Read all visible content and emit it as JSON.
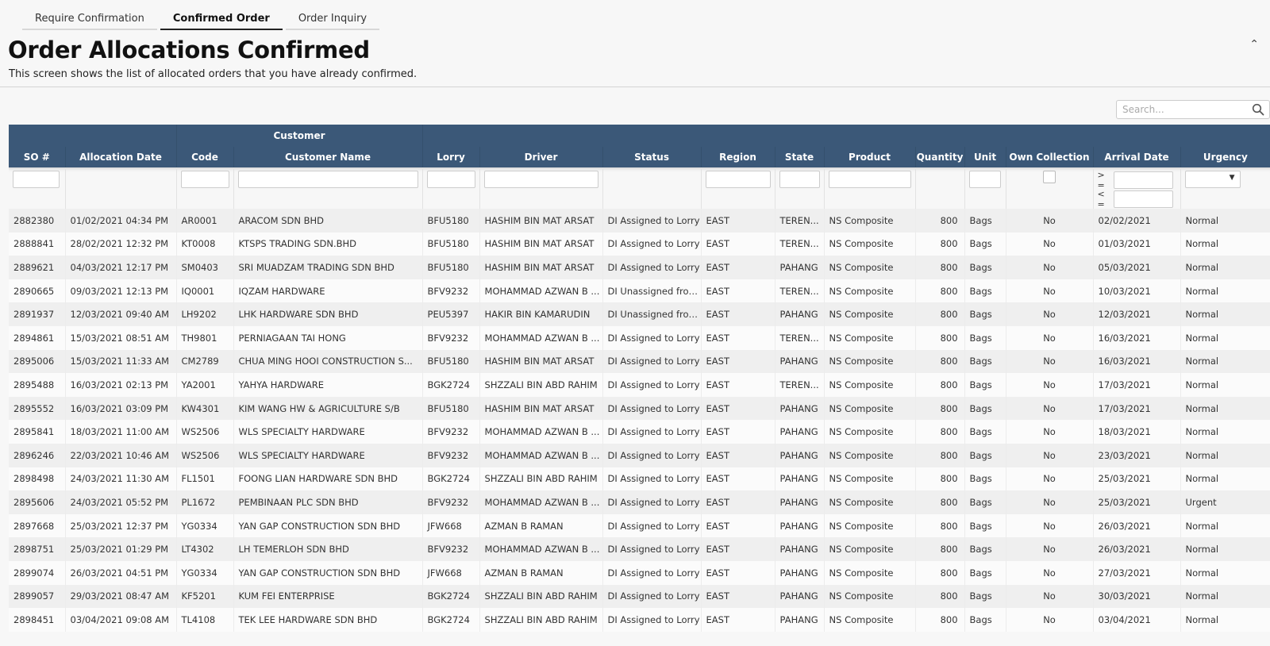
{
  "tabs": [
    {
      "label": "Require Confirmation"
    },
    {
      "label": "Confirmed Order"
    },
    {
      "label": "Order Inquiry"
    }
  ],
  "page": {
    "title": "Order Allocations Confirmed",
    "description": "This screen shows the list of allocated orders that you have already confirmed."
  },
  "search": {
    "placeholder": "Search..."
  },
  "icons": {
    "search": "search-icon",
    "collapse": "chevron-up-icon",
    "dropdown": "caret-down-icon"
  },
  "colors": {
    "header_bg": "#3b5878",
    "row_odd": "#efefef",
    "row_even": "#fbfbfb"
  },
  "table": {
    "group_header": "Customer",
    "columns": [
      "SO #",
      "Allocation Date",
      "Code",
      "Customer Name",
      "Lorry",
      "Driver",
      "Status",
      "Region",
      "State",
      "Product",
      "Quantity",
      "Unit",
      "Own Collection",
      "Arrival Date",
      "Urgency"
    ],
    "date_filter": {
      "gte_label": "> =",
      "lte_label": "< ="
    },
    "rows": [
      [
        "2882380",
        "01/02/2021 04:34 PM",
        "AR0001",
        "ARACOM SDN BHD",
        "BFU5180",
        "HASHIM BIN MAT ARSAT",
        "DI Assigned to Lorry",
        "EAST",
        "TEREN...",
        "NS Composite",
        "800",
        "Bags",
        "No",
        "02/02/2021",
        "Normal"
      ],
      [
        "2888841",
        "28/02/2021 12:32 PM",
        "KT0008",
        "KTSPS TRADING SDN.BHD",
        "BFU5180",
        "HASHIM BIN MAT ARSAT",
        "DI Assigned to Lorry",
        "EAST",
        "TEREN...",
        "NS Composite",
        "800",
        "Bags",
        "No",
        "01/03/2021",
        "Normal"
      ],
      [
        "2889621",
        "04/03/2021 12:17 PM",
        "SM0403",
        "SRI MUADZAM TRADING SDN BHD",
        "BFU5180",
        "HASHIM BIN MAT ARSAT",
        "DI Assigned to Lorry",
        "EAST",
        "PAHANG",
        "NS Composite",
        "800",
        "Bags",
        "No",
        "05/03/2021",
        "Normal"
      ],
      [
        "2890665",
        "09/03/2021 12:13 PM",
        "IQ0001",
        "IQZAM HARDWARE",
        "BFV9232",
        "MOHAMMAD AZWAN B ...",
        "DI Unassigned from...",
        "EAST",
        "TEREN...",
        "NS Composite",
        "800",
        "Bags",
        "No",
        "10/03/2021",
        "Normal"
      ],
      [
        "2891937",
        "12/03/2021 09:40 AM",
        "LH9202",
        "LHK HARDWARE SDN BHD",
        "PEU5397",
        "HAKIR BIN KAMARUDIN",
        "DI Unassigned from...",
        "EAST",
        "PAHANG",
        "NS Composite",
        "800",
        "Bags",
        "No",
        "12/03/2021",
        "Normal"
      ],
      [
        "2894861",
        "15/03/2021 08:51 AM",
        "TH9801",
        "PERNIAGAAN TAI HONG",
        "BFV9232",
        "MOHAMMAD AZWAN B ...",
        "DI Assigned to Lorry",
        "EAST",
        "TEREN...",
        "NS Composite",
        "800",
        "Bags",
        "No",
        "16/03/2021",
        "Normal"
      ],
      [
        "2895006",
        "15/03/2021 11:33 AM",
        "CM2789",
        "CHUA MING HOOI CONSTRUCTION S...",
        "BFU5180",
        "HASHIM BIN MAT ARSAT",
        "DI Assigned to Lorry",
        "EAST",
        "PAHANG",
        "NS Composite",
        "800",
        "Bags",
        "No",
        "16/03/2021",
        "Normal"
      ],
      [
        "2895488",
        "16/03/2021 02:13 PM",
        "YA2001",
        "YAHYA HARDWARE",
        "BGK2724",
        "SHZZALI BIN ABD RAHIM",
        "DI Assigned to Lorry",
        "EAST",
        "TEREN...",
        "NS Composite",
        "800",
        "Bags",
        "No",
        "17/03/2021",
        "Normal"
      ],
      [
        "2895552",
        "16/03/2021 03:09 PM",
        "KW4301",
        "KIM WANG HW & AGRICULTURE S/B",
        "BFU5180",
        "HASHIM BIN MAT ARSAT",
        "DI Assigned to Lorry",
        "EAST",
        "PAHANG",
        "NS Composite",
        "800",
        "Bags",
        "No",
        "17/03/2021",
        "Normal"
      ],
      [
        "2895841",
        "18/03/2021 11:00 AM",
        "WS2506",
        "WLS SPECIALTY HARDWARE",
        "BFV9232",
        "MOHAMMAD AZWAN B ...",
        "DI Assigned to Lorry",
        "EAST",
        "PAHANG",
        "NS Composite",
        "800",
        "Bags",
        "No",
        "18/03/2021",
        "Normal"
      ],
      [
        "2896246",
        "22/03/2021 10:46 AM",
        "WS2506",
        "WLS SPECIALTY HARDWARE",
        "BFV9232",
        "MOHAMMAD AZWAN B ...",
        "DI Assigned to Lorry",
        "EAST",
        "PAHANG",
        "NS Composite",
        "800",
        "Bags",
        "No",
        "23/03/2021",
        "Normal"
      ],
      [
        "2898498",
        "24/03/2021 11:30 AM",
        "FL1501",
        "FOONG LIAN HARDWARE SDN BHD",
        "BGK2724",
        "SHZZALI BIN ABD RAHIM",
        "DI Assigned to Lorry",
        "EAST",
        "PAHANG",
        "NS Composite",
        "800",
        "Bags",
        "No",
        "25/03/2021",
        "Normal"
      ],
      [
        "2895606",
        "24/03/2021 05:52 PM",
        "PL1672",
        "PEMBINAAN PLC SDN BHD",
        "BFV9232",
        "MOHAMMAD AZWAN B ...",
        "DI Assigned to Lorry",
        "EAST",
        "PAHANG",
        "NS Composite",
        "800",
        "Bags",
        "No",
        "25/03/2021",
        "Urgent"
      ],
      [
        "2897668",
        "25/03/2021 12:37 PM",
        "YG0334",
        "YAN GAP CONSTRUCTION SDN BHD",
        "JFW668",
        "AZMAN B RAMAN",
        "DI Assigned to Lorry",
        "EAST",
        "PAHANG",
        "NS Composite",
        "800",
        "Bags",
        "No",
        "26/03/2021",
        "Normal"
      ],
      [
        "2898751",
        "25/03/2021 01:29 PM",
        "LT4302",
        "LH TEMERLOH SDN BHD",
        "BFV9232",
        "MOHAMMAD AZWAN B ...",
        "DI Assigned to Lorry",
        "EAST",
        "PAHANG",
        "NS Composite",
        "800",
        "Bags",
        "No",
        "26/03/2021",
        "Normal"
      ],
      [
        "2899074",
        "26/03/2021 04:51 PM",
        "YG0334",
        "YAN GAP CONSTRUCTION SDN BHD",
        "JFW668",
        "AZMAN B RAMAN",
        "DI Assigned to Lorry",
        "EAST",
        "PAHANG",
        "NS Composite",
        "800",
        "Bags",
        "No",
        "27/03/2021",
        "Normal"
      ],
      [
        "2899057",
        "29/03/2021 08:47 AM",
        "KF5201",
        "KUM FEI ENTERPRISE",
        "BGK2724",
        "SHZZALI BIN ABD RAHIM",
        "DI Assigned to Lorry",
        "EAST",
        "PAHANG",
        "NS Composite",
        "800",
        "Bags",
        "No",
        "30/03/2021",
        "Normal"
      ],
      [
        "2898451",
        "03/04/2021 09:08 AM",
        "TL4108",
        "TEK LEE HARDWARE SDN BHD",
        "BGK2724",
        "SHZZALI BIN ABD RAHIM",
        "DI Assigned to Lorry",
        "EAST",
        "PAHANG",
        "NS Composite",
        "800",
        "Bags",
        "No",
        "03/04/2021",
        "Normal"
      ]
    ]
  }
}
